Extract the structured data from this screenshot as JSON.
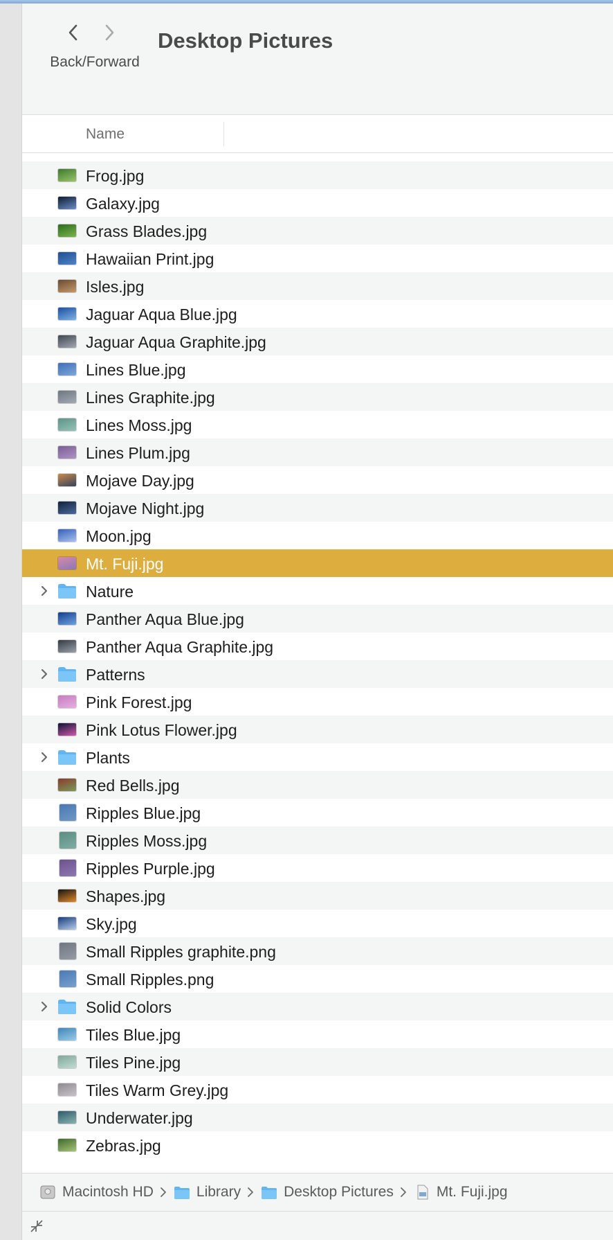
{
  "toolbar": {
    "nav_label": "Back/Forward",
    "title": "Desktop Pictures",
    "back_icon": "chevron-left-icon",
    "forward_icon": "chevron-right-icon"
  },
  "columns": {
    "name": "Name"
  },
  "files": [
    {
      "label": "Frog.jpg",
      "kind": "image",
      "colors": [
        "#3c7a2e",
        "#9bc46a"
      ]
    },
    {
      "label": "Galaxy.jpg",
      "kind": "image",
      "colors": [
        "#0e1a33",
        "#6a8fc4"
      ]
    },
    {
      "label": "Grass Blades.jpg",
      "kind": "image",
      "colors": [
        "#2f6a1f",
        "#79b64a"
      ]
    },
    {
      "label": "Hawaiian Print.jpg",
      "kind": "image",
      "colors": [
        "#1f4f8f",
        "#4f83c9"
      ]
    },
    {
      "label": "Isles.jpg",
      "kind": "image",
      "colors": [
        "#6a4a33",
        "#c49a6a"
      ]
    },
    {
      "label": "Jaguar Aqua Blue.jpg",
      "kind": "image",
      "colors": [
        "#1d4e9e",
        "#7fb2e6"
      ]
    },
    {
      "label": "Jaguar Aqua Graphite.jpg",
      "kind": "image",
      "colors": [
        "#3f4650",
        "#a2a9b3"
      ]
    },
    {
      "label": "Lines Blue.jpg",
      "kind": "image",
      "colors": [
        "#3e6fb3",
        "#7ea8dc"
      ]
    },
    {
      "label": "Lines Graphite.jpg",
      "kind": "image",
      "colors": [
        "#6e7680",
        "#a3aab3"
      ]
    },
    {
      "label": "Lines Moss.jpg",
      "kind": "image",
      "colors": [
        "#5e9488",
        "#96c2b6"
      ]
    },
    {
      "label": "Lines Plum.jpg",
      "kind": "image",
      "colors": [
        "#7a5e94",
        "#ad94c4"
      ]
    },
    {
      "label": "Mojave Day.jpg",
      "kind": "image",
      "colors": [
        "#c98a4a",
        "#33425e"
      ]
    },
    {
      "label": "Mojave Night.jpg",
      "kind": "image",
      "colors": [
        "#12203b",
        "#4a6a9b"
      ]
    },
    {
      "label": "Moon.jpg",
      "kind": "image",
      "colors": [
        "#3660b8",
        "#a8c1ee"
      ]
    },
    {
      "label": "Mt. Fuji.jpg",
      "kind": "image",
      "colors": [
        "#d98aa8",
        "#8a77b8"
      ],
      "selected": true
    },
    {
      "label": "Nature",
      "kind": "folder"
    },
    {
      "label": "Panther Aqua Blue.jpg",
      "kind": "image",
      "colors": [
        "#133e8a",
        "#6fa2e0"
      ]
    },
    {
      "label": "Panther Aqua Graphite.jpg",
      "kind": "image",
      "colors": [
        "#343a44",
        "#9aa1ab"
      ]
    },
    {
      "label": "Patterns",
      "kind": "folder"
    },
    {
      "label": "Pink Forest.jpg",
      "kind": "image",
      "colors": [
        "#c77cc0",
        "#e3b0e0"
      ]
    },
    {
      "label": "Pink Lotus Flower.jpg",
      "kind": "image",
      "colors": [
        "#0d1330",
        "#d05ab0"
      ]
    },
    {
      "label": "Plants",
      "kind": "folder"
    },
    {
      "label": "Red Bells.jpg",
      "kind": "image",
      "colors": [
        "#8a3b2c",
        "#7a9a5a"
      ]
    },
    {
      "label": "Ripples Blue.jpg",
      "kind": "image",
      "colors": [
        "#4a78b0",
        "#6f98c8"
      ],
      "square": true
    },
    {
      "label": "Ripples Moss.jpg",
      "kind": "image",
      "colors": [
        "#5a8d83",
        "#7fada3"
      ],
      "square": true
    },
    {
      "label": "Ripples Purple.jpg",
      "kind": "image",
      "colors": [
        "#6a5290",
        "#8f78b0"
      ],
      "square": true
    },
    {
      "label": "Shapes.jpg",
      "kind": "image",
      "colors": [
        "#141414",
        "#e08a2a"
      ]
    },
    {
      "label": "Sky.jpg",
      "kind": "image",
      "colors": [
        "#173c7a",
        "#b6cdea"
      ]
    },
    {
      "label": "Small Ripples graphite.png",
      "kind": "image",
      "colors": [
        "#6f7680",
        "#949ba4"
      ],
      "square": true
    },
    {
      "label": "Small Ripples.png",
      "kind": "image",
      "colors": [
        "#4b7ab3",
        "#76a0cf"
      ],
      "square": true
    },
    {
      "label": "Solid Colors",
      "kind": "folder"
    },
    {
      "label": "Tiles Blue.jpg",
      "kind": "image",
      "colors": [
        "#3f86b8",
        "#9ccbe8"
      ]
    },
    {
      "label": "Tiles Pine.jpg",
      "kind": "image",
      "colors": [
        "#7fa89a",
        "#c2dcd2"
      ]
    },
    {
      "label": "Tiles Warm Grey.jpg",
      "kind": "image",
      "colors": [
        "#8f8a8f",
        "#c8c3c8"
      ]
    },
    {
      "label": "Underwater.jpg",
      "kind": "image",
      "colors": [
        "#2f5a6a",
        "#89b3b0"
      ]
    },
    {
      "label": "Zebras.jpg",
      "kind": "image",
      "colors": [
        "#3e6a2a",
        "#a8c27a"
      ]
    }
  ],
  "pathbar": [
    {
      "label": "Macintosh HD",
      "icon": "hard-drive-icon"
    },
    {
      "label": "Library",
      "icon": "folder-icon"
    },
    {
      "label": "Desktop Pictures",
      "icon": "folder-icon"
    },
    {
      "label": "Mt. Fuji.jpg",
      "icon": "image-file-icon"
    }
  ],
  "colors": {
    "selection": "#ddad3e",
    "folder": "#5fb6f2",
    "stripe": "#f4f5f5"
  }
}
